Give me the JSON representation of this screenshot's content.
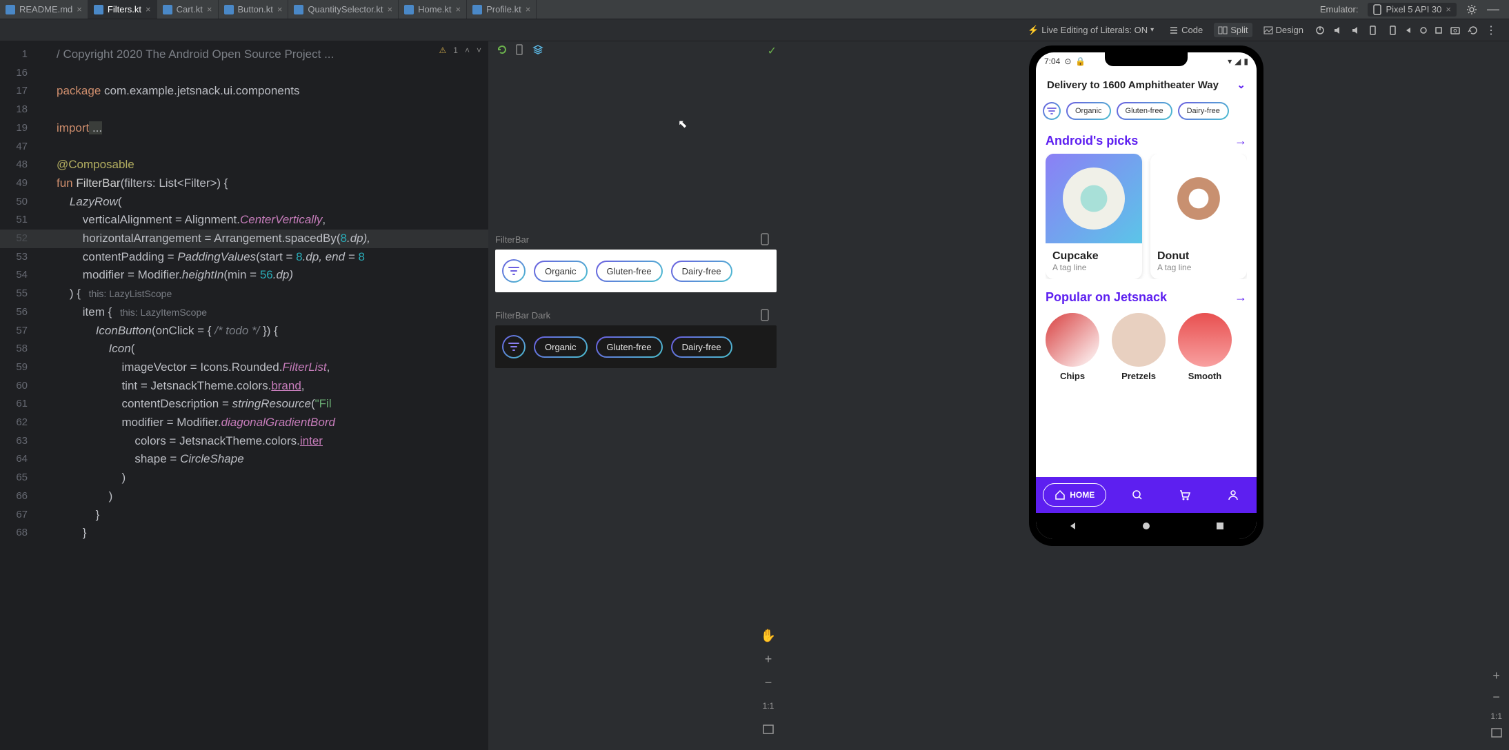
{
  "toolbar": {
    "tabs": [
      {
        "label": "README.md",
        "active": false
      },
      {
        "label": "Filters.kt",
        "active": true
      },
      {
        "label": "Cart.kt",
        "active": false
      },
      {
        "label": "Button.kt",
        "active": false
      },
      {
        "label": "QuantitySelector.kt",
        "active": false
      },
      {
        "label": "Home.kt",
        "active": false
      },
      {
        "label": "Profile.kt",
        "active": false
      }
    ],
    "emulator_label": "Emulator:",
    "device": "Pixel 5 API 30"
  },
  "toolbar2": {
    "live_edit": "Live Editing of Literals: ON",
    "code": "Code",
    "split": "Split",
    "design": "Design"
  },
  "editor": {
    "gutter": [
      "1",
      "16",
      "17",
      "18",
      "19",
      "47",
      "48",
      "49",
      "50",
      "51",
      "52",
      "53",
      "54",
      "55",
      "56",
      "57",
      "58",
      "59",
      "60",
      "61",
      "62",
      "63",
      "64",
      "65",
      "66",
      "67",
      "68"
    ],
    "warn_badge": "1",
    "code": {
      "l1_a": "/ Copyright 2020 The Android Open Source Project ...",
      "l3_kw": "package",
      "l3_b": " com.example.jetsnack.ui.components",
      "l5_kw": "import",
      "l5_b": " ...",
      "l7": "@Composable",
      "l8_kw": "fun ",
      "l8_fn": "FilterBar",
      "l8_b": "(filters: List<Filter>) {",
      "l9_a": "    ",
      "l9_fn": "LazyRow",
      "l9_b": "(",
      "l10": "        verticalAlignment = Alignment.",
      "l10_p": "CenterVertically",
      "l10_c": ",",
      "l11": "        horizontalArrangement = Arrangement.spacedBy(",
      "l11_n": "8",
      "l11_b": ".dp),",
      "l12": "        contentPadding = ",
      "l12_fn": "PaddingValues",
      "l12_b": "(start = ",
      "l12_n": "8",
      "l12_c": ".dp, end = ",
      "l12_n2": "8",
      "l13": "        modifier = Modifier.",
      "l13_fn": "heightIn",
      "l13_b": "(min = ",
      "l13_n": "56",
      "l13_c": ".dp)",
      "l14": "    ) {",
      "l14_h": "   this: LazyListScope",
      "l15": "        item {",
      "l15_h": "   this: LazyItemScope",
      "l16": "            ",
      "l16_fn": "IconButton",
      "l16_b": "(onClick = { ",
      "l16_c": "/* todo */",
      "l16_d": " }) {",
      "l17": "                ",
      "l17_fn": "Icon",
      "l17_b": "(",
      "l18": "                    imageVector = Icons.Rounded.",
      "l18_p": "FilterList",
      "l18_c": ",",
      "l19": "                    tint = JetsnackTheme.colors.",
      "l19_p": "brand",
      "l19_c": ",",
      "l20": "                    contentDescription = ",
      "l20_fn": "stringResource",
      "l20_b": "(",
      "l20_s": "\"Fil",
      "l21": "                    modifier = Modifier.",
      "l21_fn": "diagonalGradientBord",
      "l22": "                        colors = JetsnackTheme.colors.",
      "l22_p": "inter",
      "l23": "                        shape = ",
      "l23_p": "CircleShape",
      "l24": "                    )",
      "l25": "                )",
      "l26": "            }",
      "l27": "        }"
    }
  },
  "preview": {
    "label1": "FilterBar",
    "label2": "FilterBar Dark",
    "chips": [
      "Organic",
      "Gluten-free",
      "Dairy-free"
    ],
    "one_to_one": "1:1"
  },
  "emulator": {
    "time": "7:04",
    "address": "Delivery to 1600 Amphitheater Way",
    "chips": [
      "Organic",
      "Gluten-free",
      "Dairy-free"
    ],
    "section1": "Android's picks",
    "cards": [
      {
        "t": "Cupcake",
        "s": "A tag line"
      },
      {
        "t": "Donut",
        "s": "A tag line"
      }
    ],
    "section2": "Popular on Jetsnack",
    "circles": [
      "Chips",
      "Pretzels",
      "Smooth"
    ],
    "home": "HOME",
    "one_to_one": "1:1"
  }
}
